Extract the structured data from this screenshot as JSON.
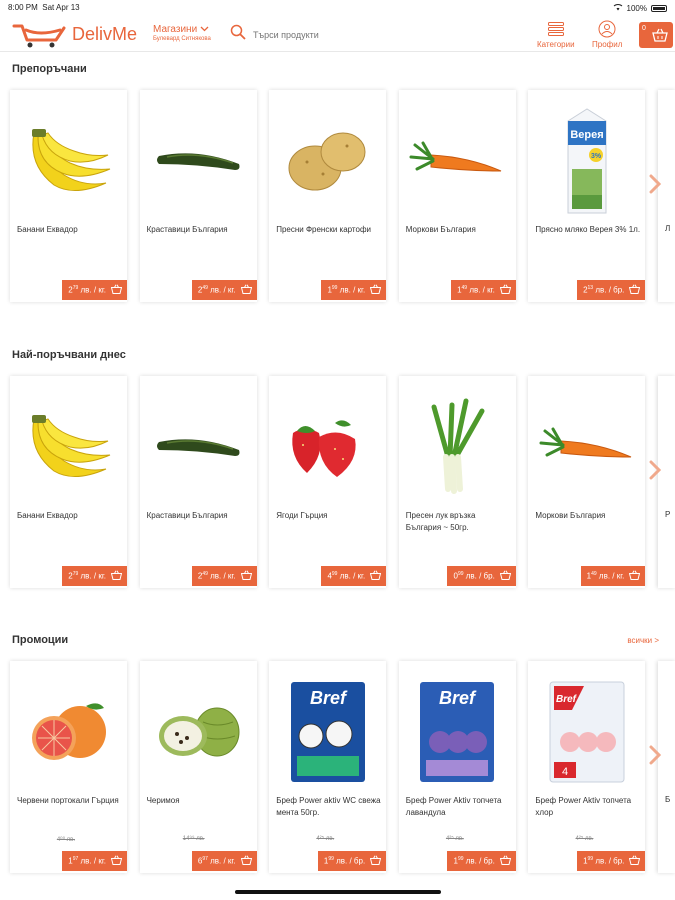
{
  "status_bar": {
    "time": "8:00 PM",
    "date": "Sat Apr 13",
    "battery": "100%"
  },
  "header": {
    "logo_text": "DelivMe",
    "store_label": "Магазини",
    "store_address": "Булевард Ситнякова",
    "search_placeholder": "Търси продукти",
    "categories_label": "Категории",
    "profile_label": "Профил",
    "cart_count": "0"
  },
  "sections": [
    {
      "title": "Препоръчани",
      "products": [
        {
          "name": "Банани Еквадор",
          "price_int": "2",
          "price_dec": "79",
          "unit": "лв. / кг.",
          "image": "banana-icon"
        },
        {
          "name": "Краставици България",
          "price_int": "2",
          "price_dec": "49",
          "unit": "лв. / кг.",
          "image": "cucumber-icon"
        },
        {
          "name": "Пресни Френски картофи",
          "price_int": "1",
          "price_dec": "99",
          "unit": "лв. / кг.",
          "image": "potato-icon"
        },
        {
          "name": "Моркови България",
          "price_int": "1",
          "price_dec": "49",
          "unit": "лв. / кг.",
          "image": "carrot-icon"
        },
        {
          "name": "Прясно мляко Верея 3% 1л.",
          "price_int": "2",
          "price_dec": "13",
          "unit": "лв. / бр.",
          "image": "milk-carton-icon",
          "brand": "Верея"
        }
      ],
      "partial_text": "Л"
    },
    {
      "title": "Най-поръчвани днес",
      "products": [
        {
          "name": "Банани Еквадор",
          "price_int": "2",
          "price_dec": "79",
          "unit": "лв. / кг.",
          "image": "banana-icon"
        },
        {
          "name": "Краставици България",
          "price_int": "2",
          "price_dec": "49",
          "unit": "лв. / кг.",
          "image": "cucumber-icon"
        },
        {
          "name": "Ягоди Гърция",
          "price_int": "4",
          "price_dec": "99",
          "unit": "лв. / кг.",
          "image": "strawberry-icon"
        },
        {
          "name": "Пресен лук връзка България ~ 50гр.",
          "price_int": "0",
          "price_dec": "99",
          "unit": "лв. / бр.",
          "image": "green-onion-icon"
        },
        {
          "name": "Моркови България",
          "price_int": "1",
          "price_dec": "49",
          "unit": "лв. / кг.",
          "image": "carrot-icon"
        }
      ],
      "partial_text": "Р"
    },
    {
      "title": "Промоции",
      "see_all": "всички >",
      "products": [
        {
          "name": "Червени портокали Гърция",
          "price_int": "1",
          "price_dec": "97",
          "unit": "лв. / кг.",
          "old_price": "4⁰⁰ лв.",
          "image": "blood-orange-icon"
        },
        {
          "name": "Черимоя",
          "price_int": "6",
          "price_dec": "97",
          "unit": "лв. / кг.",
          "old_price": "14⁹⁹ лв.",
          "image": "cherimoya-icon"
        },
        {
          "name": "Бреф Power aktiv WC свежа мента 50гр.",
          "price_int": "1",
          "price_dec": "99",
          "unit": "лв. / бр.",
          "old_price": "4²⁵ лв.",
          "image": "bref-mint-icon",
          "brand": "Bref"
        },
        {
          "name": "Бреф Power Aktiv топчета лавандула",
          "price_int": "1",
          "price_dec": "99",
          "unit": "лв. / бр.",
          "old_price": "4²⁵ лв.",
          "image": "bref-lavender-icon",
          "brand": "Bref"
        },
        {
          "name": "Бреф Power Aktiv топчета хлор",
          "price_int": "1",
          "price_dec": "99",
          "unit": "лв. / бр.",
          "old_price": "4²⁵ лв.",
          "image": "bref-chlorine-icon",
          "brand": "Bref"
        }
      ],
      "partial_text": "Б"
    }
  ],
  "colors": {
    "accent": "#e8663c",
    "text": "#333333"
  }
}
